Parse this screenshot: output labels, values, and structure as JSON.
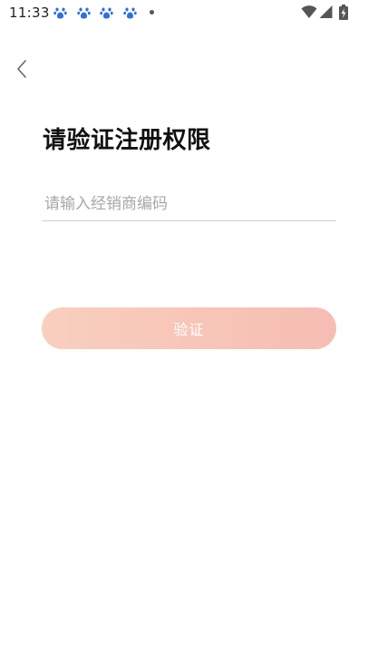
{
  "status_bar": {
    "time": "11:33",
    "notification_icons": [
      "baidu-paw-icon",
      "baidu-paw-icon",
      "baidu-paw-icon",
      "baidu-paw-icon"
    ],
    "system_icons": [
      "wifi-icon",
      "cellular-signal-icon",
      "battery-charging-icon"
    ]
  },
  "header": {
    "back_icon": "chevron-left-icon"
  },
  "main": {
    "title": "请验证注册权限",
    "dealer_code_placeholder": "请输入经销商编码",
    "dealer_code_value": "",
    "verify_label": "验证"
  },
  "colors": {
    "button_gradient_start": "#f9cfbf",
    "button_gradient_end": "#f6bdb3",
    "notification_icon": "#2f6fe0"
  }
}
